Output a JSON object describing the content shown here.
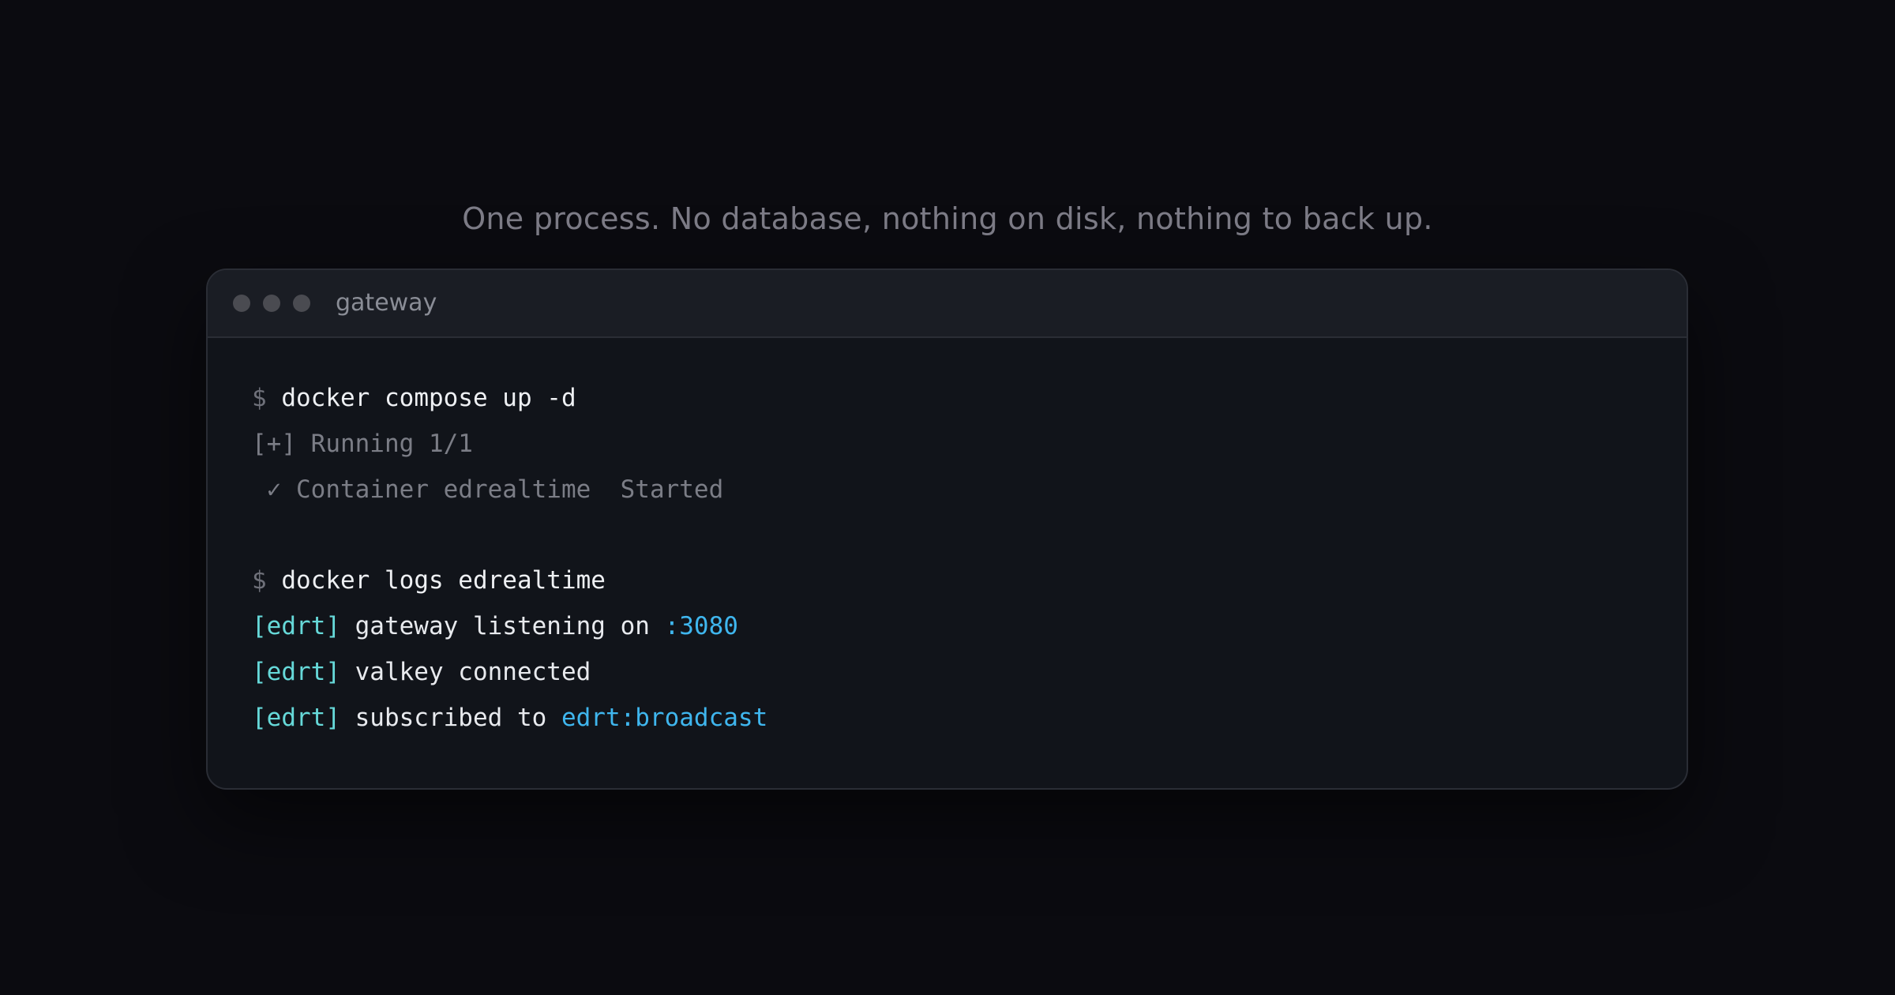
{
  "caption": "One process. No database, nothing on disk, nothing to back up.",
  "window": {
    "title": "gateway"
  },
  "terminal": {
    "prompt": "$",
    "cmd1": "docker compose up -d",
    "running": "[+] Running 1/1",
    "check": "✓",
    "container": "Container edrealtime  Started",
    "cmd2": "docker logs edrealtime",
    "log1": {
      "tag": "[edrt]",
      "text": " gateway listening on ",
      "value": ":3080"
    },
    "log2": {
      "tag": "[edrt]",
      "text": " valkey connected"
    },
    "log3": {
      "tag": "[edrt]",
      "text": " subscribed to ",
      "value": "edrt:broadcast"
    }
  },
  "colors": {
    "background": "#0b0b10",
    "window": "#11141a",
    "titlebar": "#1a1d24",
    "tag": "#66d9d9",
    "accent": "#3fb6ee",
    "muted": "#7b7d86"
  }
}
